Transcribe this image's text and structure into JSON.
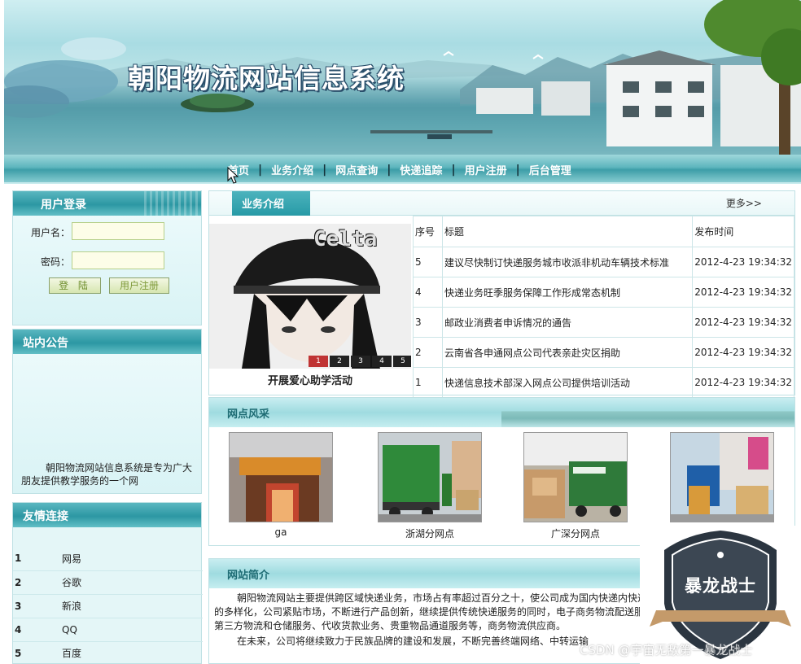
{
  "header": {
    "title": "朝阳物流网站信息系统"
  },
  "nav": {
    "items": [
      "首页",
      "业务介绍",
      "网点查询",
      "快递追踪",
      "用户注册",
      "后台管理"
    ],
    "separator": "|"
  },
  "login": {
    "title": "用户登录",
    "username_label": "用户名",
    "password_label": "密码",
    "login_button": "登 陆",
    "register_button": "用户注册"
  },
  "notice": {
    "title": "站内公告",
    "text": "朝阳物流网站信息系统是专为广大朋友提供教学服务的一个网"
  },
  "friend_links": {
    "title": "友情连接",
    "items": [
      {
        "num": "1",
        "name": "网易"
      },
      {
        "num": "2",
        "name": "谷歌"
      },
      {
        "num": "3",
        "name": "新浪"
      },
      {
        "num": "4",
        "name": "QQ"
      },
      {
        "num": "5",
        "name": "百度"
      }
    ]
  },
  "business": {
    "tab": "业务介绍",
    "more": "更多>>",
    "photo_title_text": "Celta",
    "photo_caption": "开展爱心助学活动",
    "photo_pages": [
      "1",
      "2",
      "3",
      "4",
      "5"
    ],
    "columns": [
      "序号",
      "标题",
      "发布时间"
    ],
    "rows": [
      {
        "num": "5",
        "title": "建议尽快制订快递服务城市收派非机动车辆技术标准",
        "date": "2012-4-23  19:34:32"
      },
      {
        "num": "4",
        "title": "快递业务旺季服务保障工作形成常态机制",
        "date": "2012-4-23  19:34:32"
      },
      {
        "num": "3",
        "title": "邮政业消费者申诉情况的通告",
        "date": "2012-4-23  19:34:32"
      },
      {
        "num": "2",
        "title": "云南省各申通网点公司代表亲赴灾区捐助",
        "date": "2012-4-23  19:34:32"
      },
      {
        "num": "1",
        "title": "快递信息技术部深入网点公司提供培训活动",
        "date": "2012-4-23  19:34:32"
      }
    ]
  },
  "branches": {
    "title": "网点风采",
    "items": [
      {
        "name": "ga"
      },
      {
        "name": "浙湖分网点"
      },
      {
        "name": "广深分网点"
      },
      {
        "name": ""
      }
    ]
  },
  "intro": {
    "title": "网站简介",
    "p1": "朝阳物流网站主要提供跨区域快递业务，市场占有率超过百分之十，使公司成为国内快递内快递需求的多样化，公司紧贴市场，不断进行产品创新，继续提供传统快递服务的同时，电子商务物流配送服务、第三方物流和仓储服务、代收货款业务、贵重物品通道服务等，商务物流供应商。",
    "p2": "在未来，公司将继续致力于民族品牌的建设和发展，不断完善终端网络、中转运输"
  },
  "watermark": {
    "badge_text": "暴龙战士",
    "footer_text": "CSDN @宇宙无敌第一暴龙战士"
  }
}
